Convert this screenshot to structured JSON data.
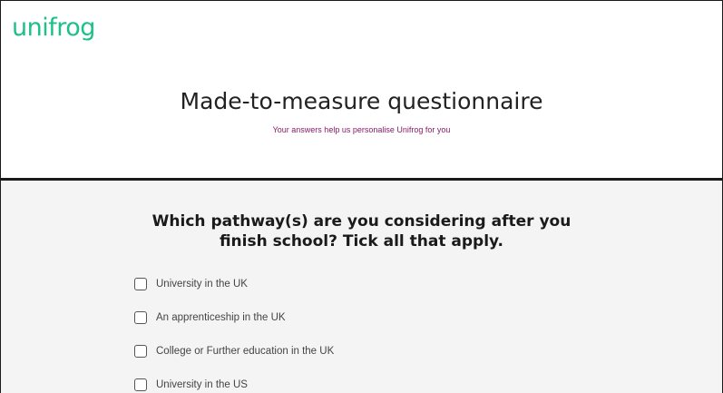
{
  "brand": {
    "logo_text": "unifrog",
    "logo_color": "#1dbf8a"
  },
  "header": {
    "title": "Made-to-measure questionnaire",
    "subtitle": "Your answers help us personalise Unifrog for you",
    "subtitle_color": "#8a1a6a"
  },
  "question": {
    "line1": "Which pathway(s) are you considering after you",
    "line2": "finish school? Tick all that apply.",
    "options": [
      {
        "label": "University in the UK",
        "checked": false
      },
      {
        "label": "An apprenticeship in the UK",
        "checked": false
      },
      {
        "label": "College or Further education in the UK",
        "checked": false
      },
      {
        "label": "University in the US",
        "checked": false
      }
    ]
  }
}
